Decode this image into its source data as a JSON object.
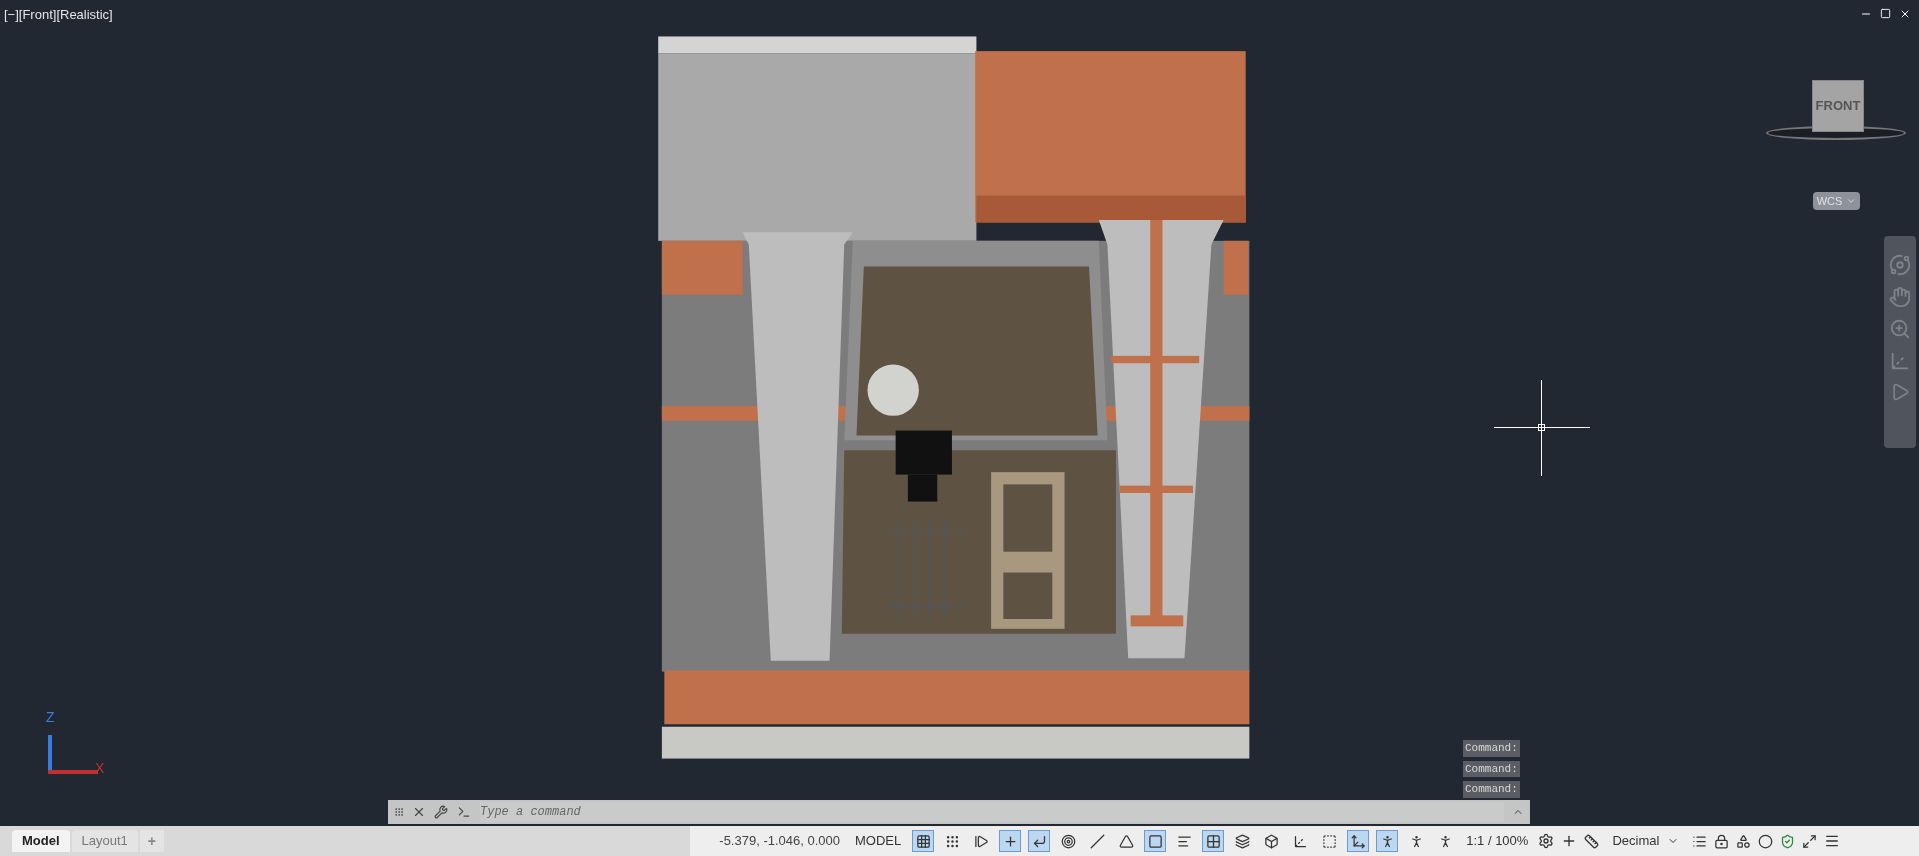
{
  "viewport": {
    "label": "[−][Front][Realistic]",
    "viewcube_face": "FRONT",
    "ucs_menu": "WCS",
    "axis_labels": [
      "Z",
      "X"
    ]
  },
  "command_history": [
    "Command:",
    "Command:",
    "Command:"
  ],
  "command_line": {
    "placeholder": "Type a command"
  },
  "layout_tabs": [
    {
      "label": "Model",
      "selected": true
    },
    {
      "label": "Layout1",
      "selected": false
    }
  ],
  "add_tab": "+",
  "status_bar": {
    "coordinates": "-5.379, -1.046, 0.000",
    "space": "MODEL",
    "annotation_scale": "1:1 / 100%",
    "units": "Decimal",
    "toggles": [
      {
        "selected": true
      },
      {
        "selected": false
      },
      {
        "selected": false
      },
      {
        "selected": true
      },
      {
        "selected": true
      },
      {
        "selected": false
      },
      {
        "selected": false
      },
      {
        "selected": false
      },
      {
        "selected": true
      },
      {
        "selected": false
      },
      {
        "selected": true
      },
      {
        "selected": false
      },
      {
        "selected": false
      },
      {
        "selected": false
      },
      {
        "selected": false
      },
      {
        "selected": true
      },
      {
        "selected": true
      },
      {
        "selected": false
      },
      {
        "selected": false
      }
    ]
  }
}
